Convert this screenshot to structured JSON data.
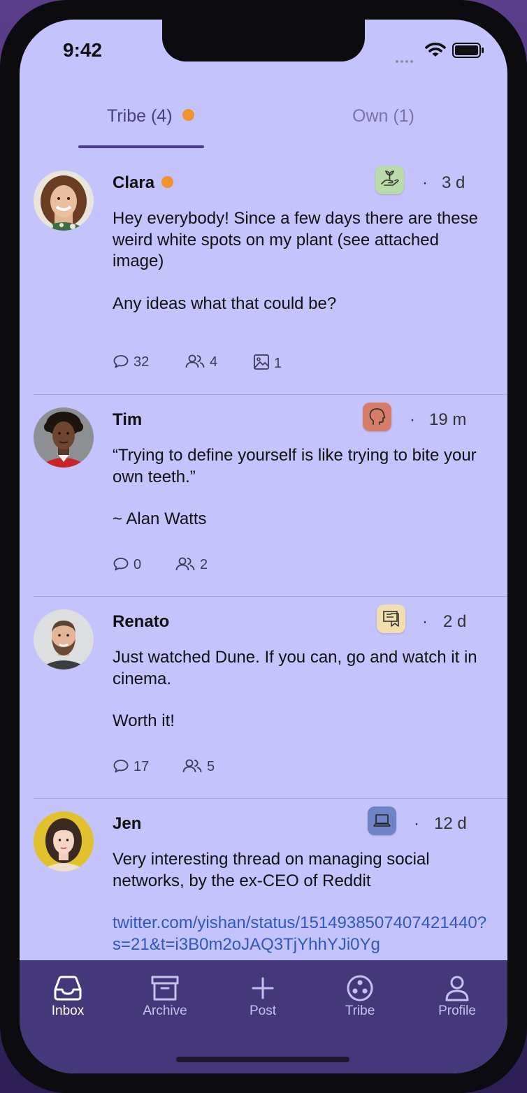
{
  "status_bar": {
    "time": "9:42"
  },
  "tabs": [
    {
      "label": "Tribe (4)",
      "active": true,
      "has_unread": true
    },
    {
      "label": "Own (1)",
      "active": false
    }
  ],
  "posts": [
    {
      "author": "Clara",
      "online": true,
      "category_icon": "plant-hand-icon",
      "category_color": "#b9dba9",
      "separator": "·",
      "time": "3 d",
      "paragraphs": [
        "Hey everybody! Since a few days there are these weird white spots on my plant (see attached image)",
        "Any ideas what that could be?"
      ],
      "comments": "32",
      "participants": "4",
      "attachments": "1"
    },
    {
      "author": "Tim",
      "online": false,
      "category_icon": "head-profile-icon",
      "category_color": "#d67d67",
      "separator": "·",
      "time": "19 m",
      "paragraphs": [
        "“Trying to define yourself is like trying to bite your own teeth.”",
        "~ Alan Watts"
      ],
      "comments": "0",
      "participants": "2"
    },
    {
      "author": "Renato",
      "online": false,
      "category_icon": "cinema-screen-icon",
      "category_color": "#f2ddb0",
      "separator": "·",
      "time": "2 d",
      "paragraphs": [
        "Just watched Dune. If you can, go and watch it in cinema.",
        "Worth it!"
      ],
      "comments": "17",
      "participants": "5"
    },
    {
      "author": "Jen",
      "online": false,
      "category_icon": "laptop-icon",
      "category_color": "#6e84c6",
      "separator": "·",
      "time": "12 d",
      "paragraphs": [
        "Very interesting thread on managing social networks, by the ex-CEO of Reddit"
      ],
      "link": "twitter.com/yishan/status/1514938507407421440?s=21&t=i3B0m2oJAQ3TjYhhYJi0Yg"
    }
  ],
  "tabbar": [
    {
      "label": "Inbox",
      "icon": "inbox-icon",
      "active": true
    },
    {
      "label": "Archive",
      "icon": "archive-box-icon",
      "active": false
    },
    {
      "label": "Post",
      "icon": "plus-icon",
      "active": false
    },
    {
      "label": "Tribe",
      "icon": "tribe-icon",
      "active": false
    },
    {
      "label": "Profile",
      "icon": "user-icon",
      "active": false
    }
  ],
  "colors": {
    "background": "#c5c3fb",
    "tabbar": "#45387a",
    "accent": "#4a3f86",
    "online": "#f0922e",
    "link": "#2f58c4"
  }
}
